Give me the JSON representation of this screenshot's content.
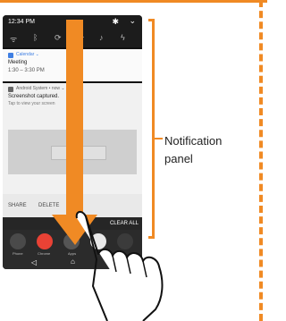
{
  "status_bar": {
    "time": "12:34 PM",
    "icons": [
      "gear-icon",
      "chevron-down-icon"
    ]
  },
  "quick_settings": {
    "icons": [
      "wifi-icon",
      "bluetooth-icon",
      "rotate-icon",
      "airplane-icon",
      "bell-icon",
      "flashlight-icon"
    ]
  },
  "notifications": {
    "calendar": {
      "app": "Calendar ⌄",
      "title": "Meeting",
      "time": "1:30 – 3:30 PM"
    },
    "screenshot": {
      "app": "Android System • now ⌄",
      "title": "Screenshot captured.",
      "subtitle": "Tap to view your screen",
      "actions": {
        "share": "SHARE",
        "delete": "DELETE"
      }
    }
  },
  "clear_all": "CLEAR ALL",
  "dock": {
    "apps": [
      {
        "label": "Phone",
        "color": "#4a4a4a"
      },
      {
        "label": "Chrome",
        "color": "#e94235"
      },
      {
        "label": "Apps",
        "color": "#555555"
      },
      {
        "label": "",
        "color": "#e8e8e8"
      },
      {
        "label": "",
        "color": "#3b3b3b"
      }
    ],
    "nav": {
      "back": "◁",
      "home": "⌂"
    }
  },
  "callout": {
    "line1": "Notification",
    "line2": "panel"
  },
  "colors": {
    "accent_orange": "#f08a24",
    "calendar_blue": "#3f7fe3"
  }
}
